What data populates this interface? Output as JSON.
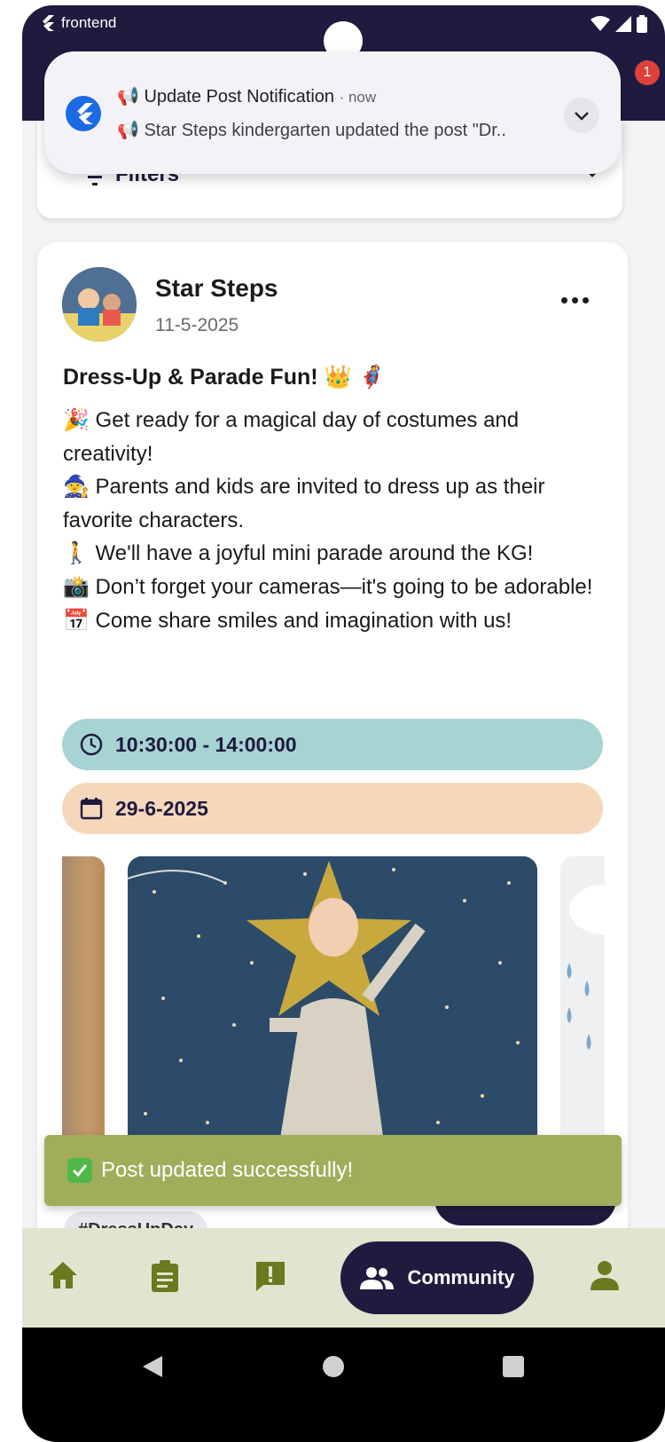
{
  "status_bar": {
    "app_name": "frontend"
  },
  "header": {
    "badge_count": "1"
  },
  "notification": {
    "title": "📢 Update Post Notification",
    "time": "· now",
    "text": "📢 Star Steps kindergarten updated the post \"Dr.."
  },
  "filters": {
    "label": "Filters"
  },
  "post": {
    "author": "Star Steps",
    "date": "11-5-2025",
    "title": "Dress-Up & Parade Fun! 👑 🦸",
    "body": [
      "🎉 Get ready for a magical day of costumes and creativity!",
      "🧙 Parents and kids are invited to dress up as their favorite characters.",
      "🚶 We'll have a joyful mini parade around the KG!",
      "📸 Don’t forget your cameras—it's going to be adorable!",
      "📅 Come share smiles and imagination with us!"
    ],
    "time_range": "10:30:00 - 14:00:00",
    "event_date": "29-6-2025",
    "tag": "#DressUpDay"
  },
  "snackbar": {
    "message": "Post updated successfully!"
  },
  "bottom_nav": {
    "items": [
      {
        "icon": "home-icon"
      },
      {
        "icon": "clipboard-icon"
      },
      {
        "icon": "report-icon"
      },
      {
        "icon": "community-icon",
        "label": "Community",
        "active": true
      },
      {
        "icon": "profile-icon"
      }
    ]
  },
  "colors": {
    "header": "#1f1b3f",
    "time_pill": "#a7d3d3",
    "date_pill": "#f5d8bb",
    "snackbar": "#a2ad5c",
    "nav_bg": "#e1e4cf",
    "accent_olive": "#6b7a1e"
  }
}
